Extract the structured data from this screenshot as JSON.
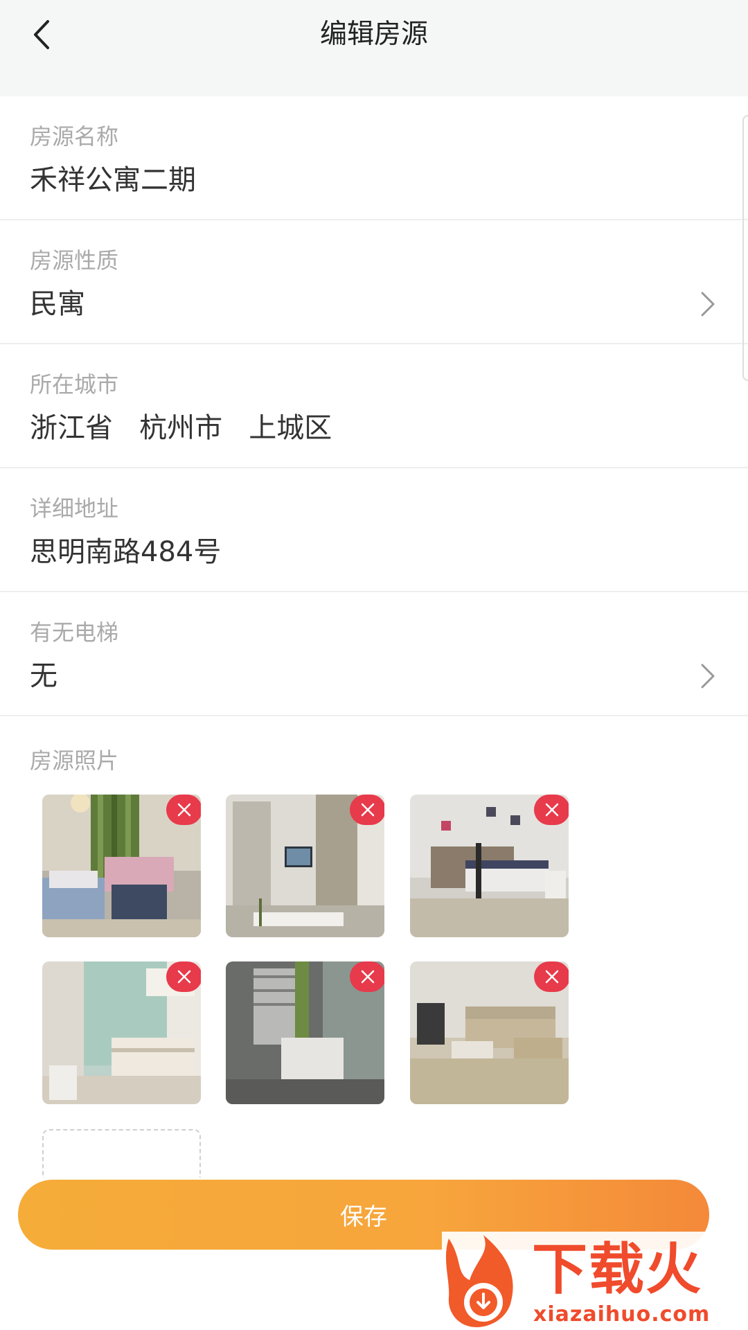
{
  "header": {
    "title": "编辑房源",
    "back_icon": "chevron-left-icon"
  },
  "fields": [
    {
      "label": "房源名称",
      "value": "禾祥公寓二期",
      "has_chevron": false
    },
    {
      "label": "房源性质",
      "value": "民寓",
      "has_chevron": true
    },
    {
      "label": "所在城市",
      "value": "浙江省   杭州市   上城区",
      "has_chevron": false
    },
    {
      "label": "详细地址",
      "value": "思明南路484号",
      "has_chevron": false
    },
    {
      "label": "有无电梯",
      "value": "无",
      "has_chevron": true
    }
  ],
  "photos": {
    "label": "房源照片",
    "delete_icon": "close-icon",
    "items": [
      {
        "name": "living-room-sofa-bed"
      },
      {
        "name": "living-room-tv"
      },
      {
        "name": "bedroom-bed"
      },
      {
        "name": "room-desk"
      },
      {
        "name": "bedroom-window"
      },
      {
        "name": "living-room-sofa"
      }
    ]
  },
  "actions": {
    "save_label": "保存"
  },
  "watermark": {
    "brand": "下载火",
    "url": "xiazaihuo.com"
  },
  "colors": {
    "header_bg": "#f5f6f6",
    "label": "#aaaaaa",
    "value": "#333333",
    "delete_badge": "#e73a4b",
    "save_gradient_start": "#f5ac38",
    "save_gradient_end": "#f4893a",
    "watermark": "#ef4b2c"
  }
}
